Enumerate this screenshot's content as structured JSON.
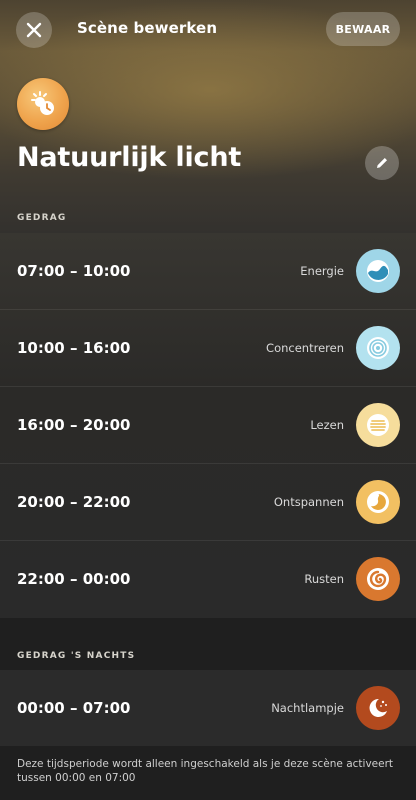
{
  "header": {
    "title": "Scène bewerken",
    "save_label": "BEWAAR"
  },
  "scene": {
    "name": "Natuurlijk licht",
    "icon": "sun-clock-icon",
    "icon_color": "#efa44d"
  },
  "sections": {
    "behavior_label": "GEDRAG",
    "night_label": "GEDRAG 'S NACHTS"
  },
  "slots": [
    {
      "time": "07:00 – 10:00",
      "label": "Energie",
      "icon": "energize-icon",
      "color": "#9fd6e8"
    },
    {
      "time": "10:00 – 16:00",
      "label": "Concentreren",
      "icon": "concentrate-icon",
      "color": "#b3e2ef"
    },
    {
      "time": "16:00 – 20:00",
      "label": "Lezen",
      "icon": "read-icon",
      "color": "#f6dd9c"
    },
    {
      "time": "20:00 – 22:00",
      "label": "Ontspannen",
      "icon": "relax-icon",
      "color": "#f2c062"
    },
    {
      "time": "22:00 – 00:00",
      "label": "Rusten",
      "icon": "rest-icon",
      "color": "#d9782f"
    }
  ],
  "night_slot": {
    "time": "00:00 – 07:00",
    "label": "Nachtlampje",
    "icon": "nightlight-icon",
    "color": "#b34a1e"
  },
  "footnote": "Deze tijdsperiode wordt alleen ingeschakeld als je deze scène activeert tussen 00:00 en 07:00"
}
